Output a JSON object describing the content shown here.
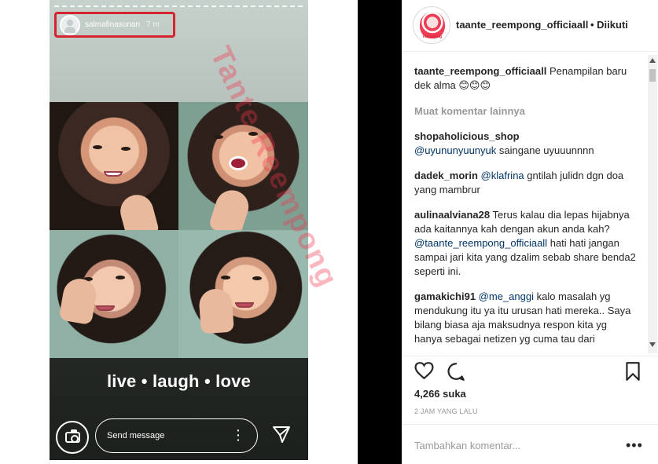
{
  "story": {
    "username": "salmafinasunan",
    "time": "7 m",
    "caption": "live • laugh • love",
    "message_placeholder": "Send message"
  },
  "post": {
    "account": "taante_reempong_officiaall",
    "follow_text": "• Diikuti",
    "caption_user": "taante_reempong_officiaall",
    "caption_text": "Penampilan baru dek alma 😊😊😊",
    "load_more": "Muat komentar lainnya",
    "comments": [
      {
        "user": "shopaholicious_shop",
        "mention": "@uyununyuunyuk",
        "text": "saingane uyuuunnnn"
      },
      {
        "user": "dadek_morin",
        "mention": "@klafrina",
        "text": "gntilah julidn dgn doa yang mambrur"
      },
      {
        "user": "aulinaalviana28",
        "text": "Terus kalau dia lepas hijabnya ada kaitannya kah dengan akun anda kah?",
        "mention": "@taante_reempong_officiaall",
        "text2": "hati hati jangan sampai jari kita yang dzalim sebab share benda2 seperti ini."
      },
      {
        "user": "gamakichi91",
        "mention": "@me_anggi",
        "text": "kalo masalah yg mendukung itu ya itu urusan hati mereka.. Saya bilang biasa aja maksudnya respon kita yg hanya sebagai netizen yg cuma tau dari"
      }
    ],
    "likes": "4,266 suka",
    "time": "2 JAM YANG LALU",
    "add_comment_placeholder": "Tambahkan komentar...",
    "more": "•••"
  },
  "icons": {
    "story_camera": "camera-icon",
    "story_send": "send-icon",
    "like": "heart-icon",
    "comment": "comment-icon",
    "bookmark": "bookmark-icon"
  },
  "colors": {
    "highlight": "#d3242f",
    "watermark": "#f4314b",
    "mention": "#003569"
  }
}
